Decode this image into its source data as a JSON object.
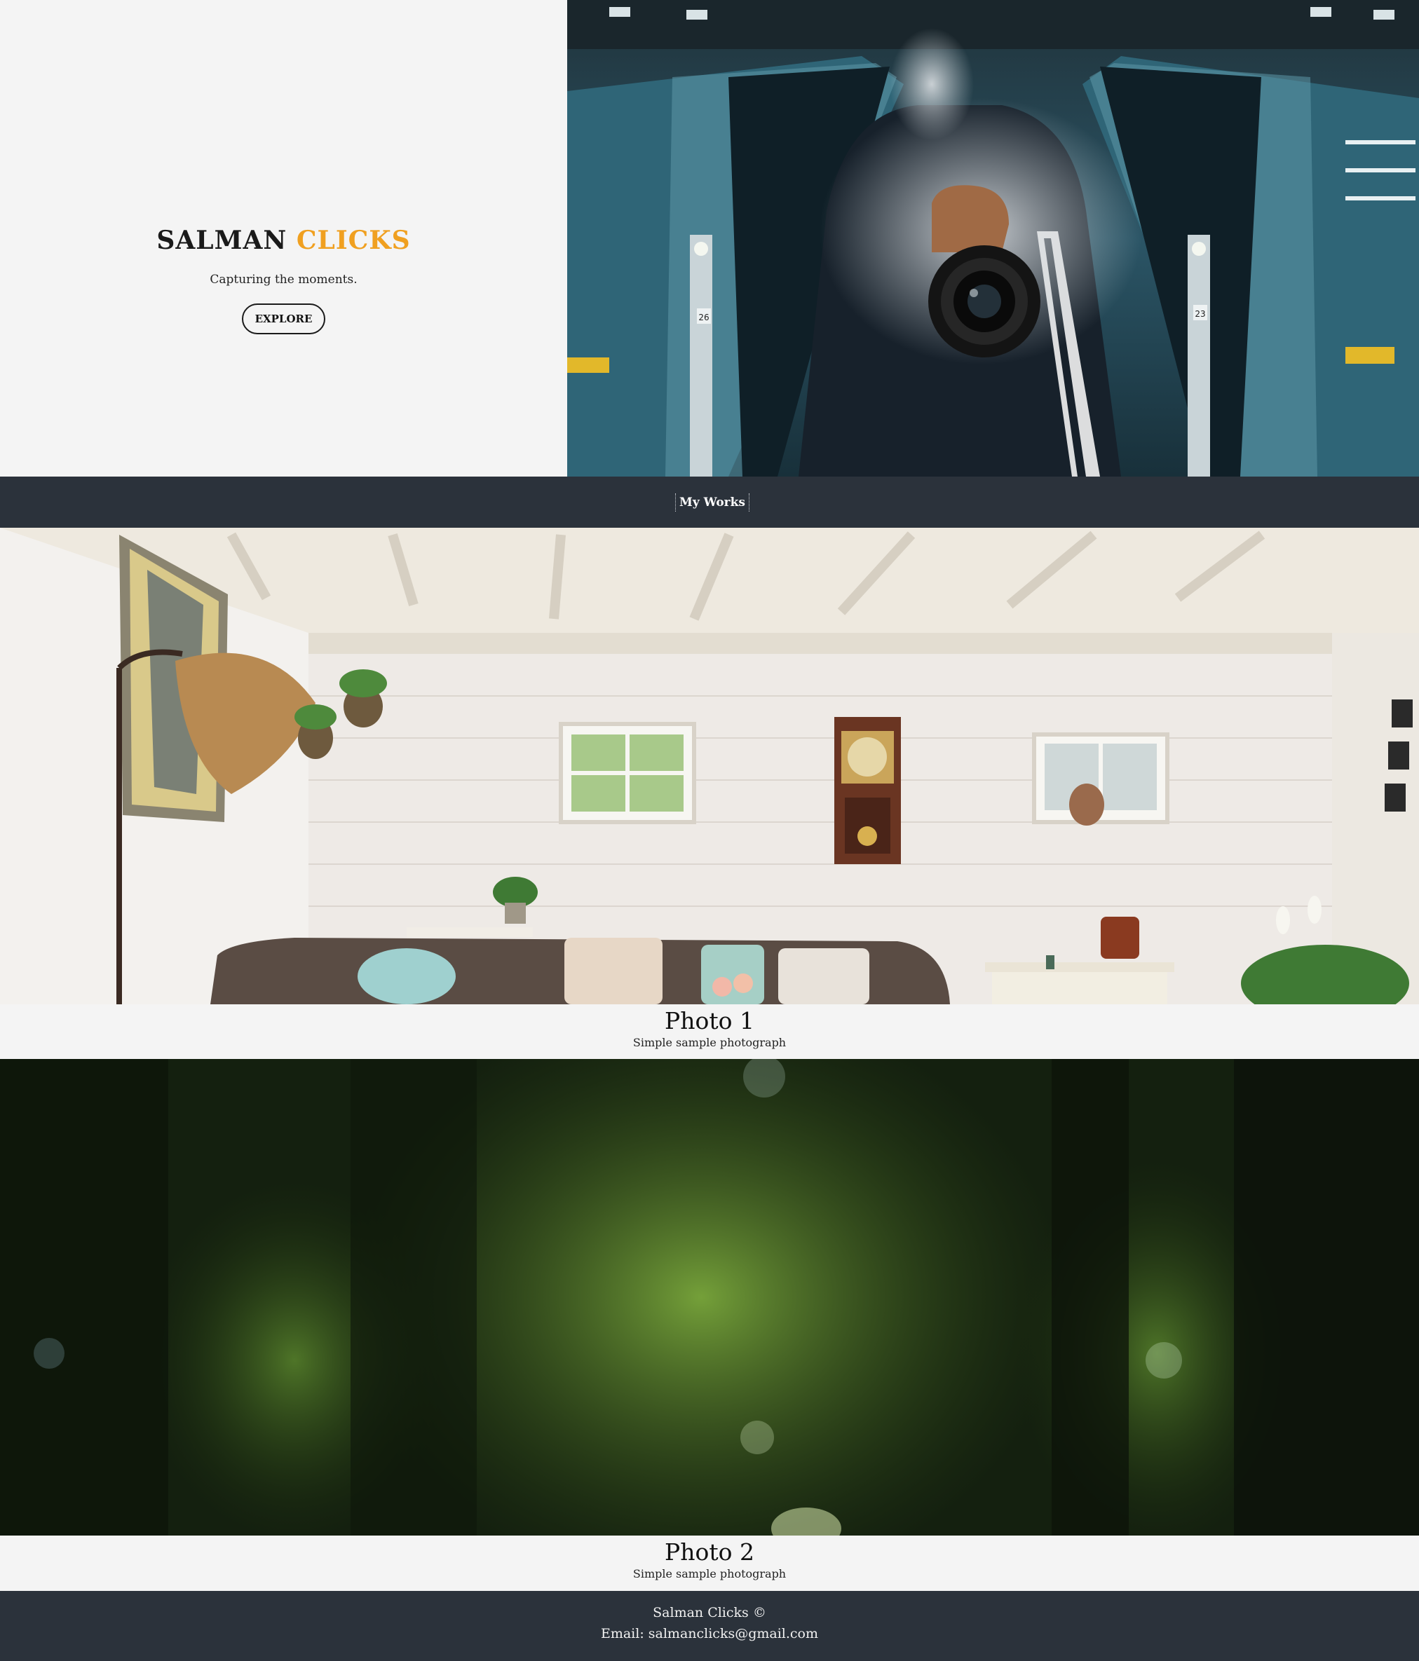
{
  "hero": {
    "brand_first": "SALMAN",
    "brand_accent": "CLICKS",
    "tagline": "Capturing the moments.",
    "explore_label": "EXPLORE",
    "accent_color": "#f0a020",
    "escalator_left_number": "26",
    "escalator_right_number": "23"
  },
  "nav": {
    "my_works_label": "My Works",
    "background": "#2b323b"
  },
  "gallery": [
    {
      "title": "Photo 1",
      "description": "Simple sample photograph"
    },
    {
      "title": "Photo 2",
      "description": "Simple sample photograph"
    }
  ],
  "footer": {
    "copyright": "Salman Clicks ©",
    "email": "Email: salmanclicks@gmail.com"
  }
}
